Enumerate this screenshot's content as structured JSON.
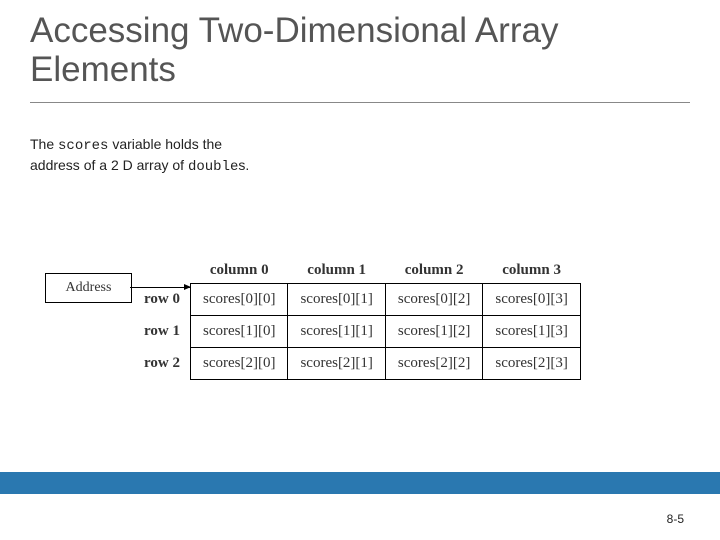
{
  "title": "Accessing Two-Dimensional Array Elements",
  "description": {
    "pre": "The ",
    "var": "scores",
    "mid": " variable holds the address of a 2 D array of ",
    "type": "double",
    "post": "s."
  },
  "address_label": "Address",
  "columns": [
    "column 0",
    "column 1",
    "column 2",
    "column 3"
  ],
  "rows": [
    "row 0",
    "row 1",
    "row 2"
  ],
  "cells": [
    [
      "scores[0][0]",
      "scores[0][1]",
      "scores[0][2]",
      "scores[0][3]"
    ],
    [
      "scores[1][0]",
      "scores[1][1]",
      "scores[1][2]",
      "scores[1][3]"
    ],
    [
      "scores[2][0]",
      "scores[2][1]",
      "scores[2][2]",
      "scores[2][3]"
    ]
  ],
  "page_number": "8-5"
}
